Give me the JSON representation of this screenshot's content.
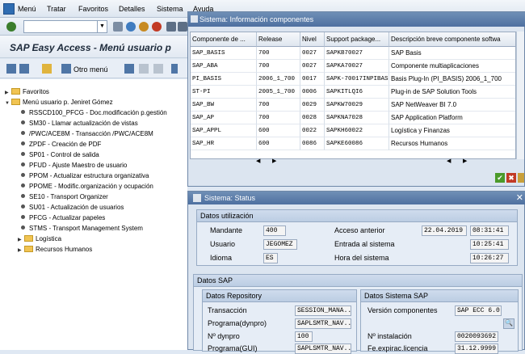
{
  "menubar": {
    "items": [
      "Menú",
      "Tratar",
      "Favoritos",
      "Detalles",
      "Sistema",
      "Ayuda"
    ]
  },
  "title": "SAP Easy Access  -  Menú usuario p",
  "app_toolbar": {
    "other_menu_label": "Otro menú"
  },
  "tree": {
    "favorites": "Favoritos",
    "user_menu": "Menú usuario p. Jeniret Gómez",
    "items": [
      "RSSCD100_PFCG - Doc.modificación p.gestión",
      "SM30 - Llamar actualización de vistas",
      "/PWC/ACE8M - Transacción /PWC/ACE8M",
      "ZPDF - Creación de PDF",
      "SP01 - Control de salida",
      "PFUD - Ajuste Maestro de usuario",
      "PPOM - Actualizar estructura organizativa",
      "PPOME - Modific.organización y ocupación",
      "SE10 - Transport Organizer",
      "SU01 - Actualización de usuarios",
      "PFCG - Actualizar papeles",
      "STMS - Transport Management System"
    ],
    "folders": [
      "Logística",
      "Recursos Humanos"
    ]
  },
  "components_dialog": {
    "title": "Sistema: Información componentes",
    "columns": [
      "Componente de ...",
      "Release",
      "Nivel",
      "Support package...",
      "Descripción breve componente softwa"
    ],
    "rows": [
      [
        "SAP_BASIS",
        "700",
        "0027",
        "SAPKB70027",
        "SAP Basis"
      ],
      [
        "SAP_ABA",
        "700",
        "0027",
        "SAPKA70027",
        "Componente multiaplicaciones"
      ],
      [
        "PI_BASIS",
        "2006_1_700",
        "0017",
        "SAPK-70017INPIBASIS",
        "Basis Plug-In (PI_BASIS) 2006_1_700"
      ],
      [
        "ST-PI",
        "2005_1_700",
        "0006",
        "SAPKITLQI6",
        "Plug-in de SAP Solution Tools"
      ],
      [
        "SAP_BW",
        "700",
        "0029",
        "SAPKW70029",
        "SAP NetWeaver BI 7.0"
      ],
      [
        "SAP_AP",
        "700",
        "0028",
        "SAPKNA7028",
        "SAP Application Platform"
      ],
      [
        "SAP_APPL",
        "600",
        "0022",
        "SAPKH60022",
        "Logística y Finanzas"
      ],
      [
        "SAP_HR",
        "600",
        "0086",
        "SAPKE60086",
        "Recursos Humanos"
      ]
    ]
  },
  "status_dialog": {
    "title": "Sistema: Status",
    "usage": {
      "header": "Datos utilización",
      "mandante_label": "Mandante",
      "mandante": "400",
      "usuario_label": "Usuario",
      "usuario": "JEGOMEZ",
      "idioma_label": "Idioma",
      "idioma": "ES",
      "acceso_label": "Acceso anterior",
      "acceso_fecha": "22.04.2019",
      "acceso_hora": "08:31:41",
      "entrada_label": "Entrada al sistema",
      "entrada_hora": "10:25:41",
      "hora_label": "Hora del sistema",
      "hora": "10:26:27"
    },
    "sap": {
      "header": "Datos SAP",
      "repo_header": "Datos Repository",
      "transaccion_label": "Transacción",
      "transaccion": "SESSION_MANA...",
      "programa_dynpro_label": "Programa(dynpro)",
      "programa_dynpro": "SAPLSMTR_NAV...",
      "dynpro_label": "Nº dynpro",
      "dynpro": "100",
      "programa_gui_label": "Programa(GUI)",
      "programa_gui": "SAPLSMTR_NAV...",
      "system_header": "Datos Sistema SAP",
      "version_label": "Versión componentes",
      "version": "SAP ECC 6.0",
      "instalacion_label": "Nº instalación",
      "instalacion": "0020093692",
      "licencia_label": "Fe.expirac.licencia",
      "licencia": "31.12.9999"
    }
  }
}
